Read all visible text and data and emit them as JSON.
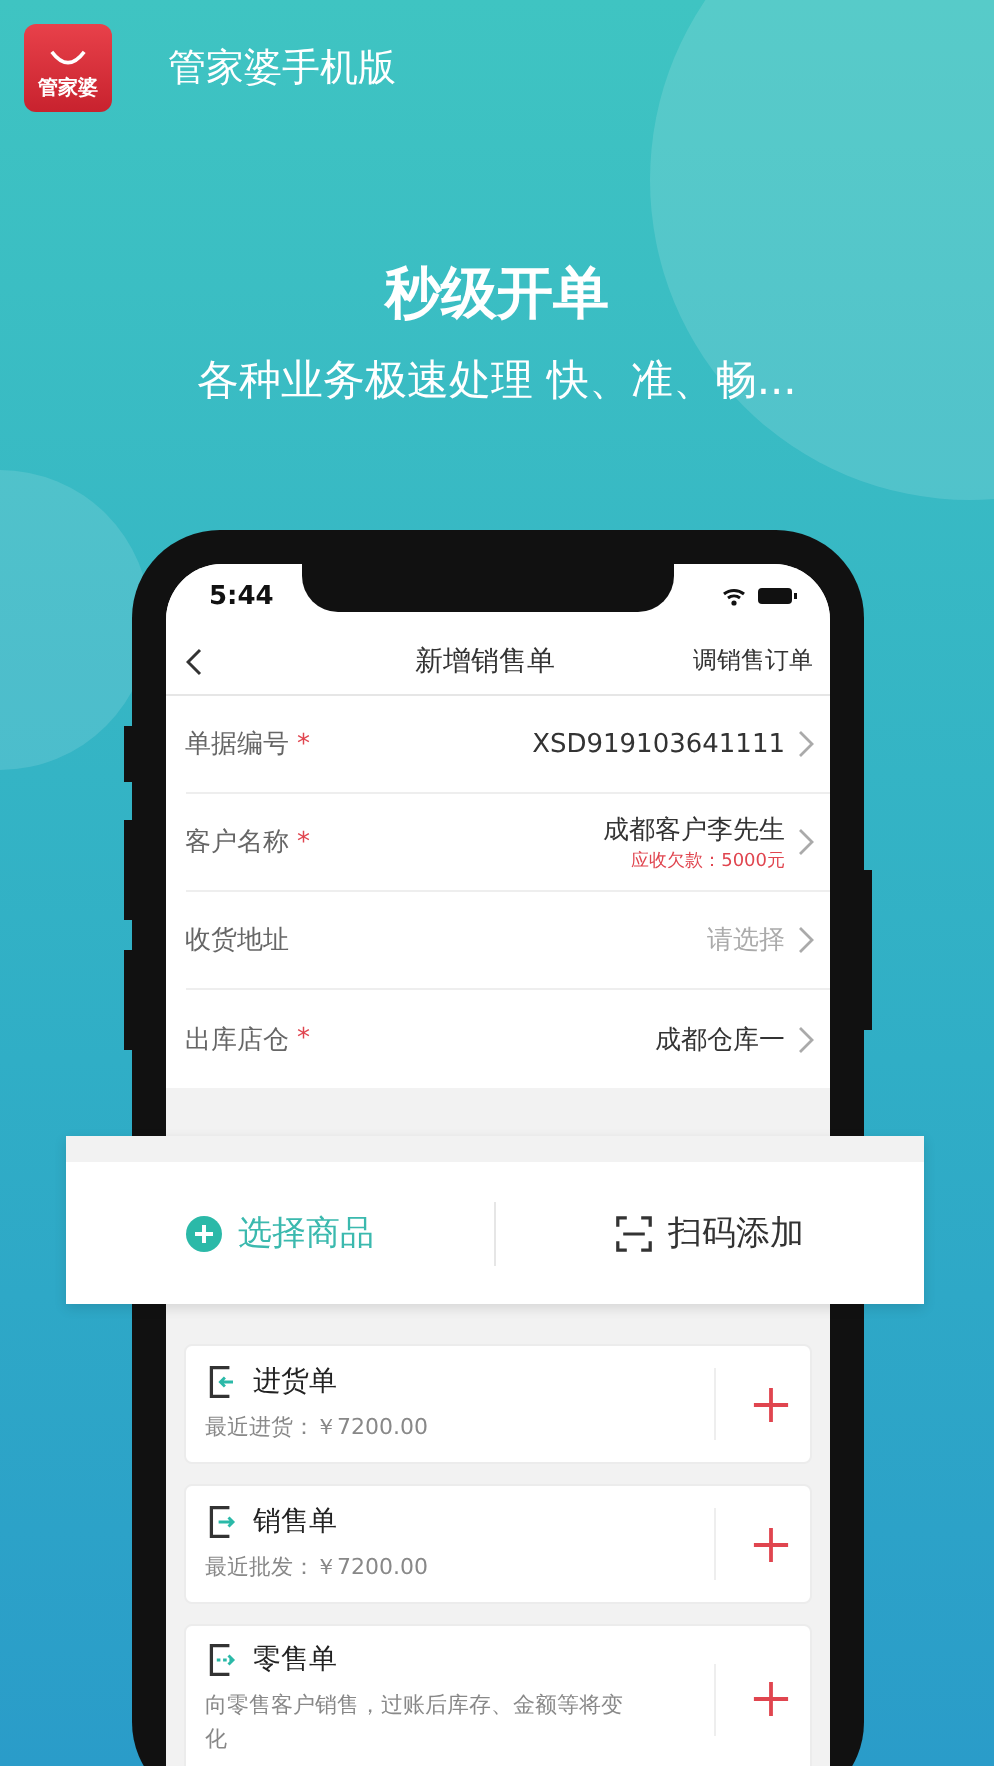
{
  "app": {
    "icon_label": "管家婆",
    "name": "管家婆手机版"
  },
  "headline": "秒级开单",
  "tagline": "各种业务极速处理 快、准、畅...",
  "phone": {
    "status_time": "5:44",
    "nav": {
      "title": "新增销售单",
      "action": "调销售订单"
    },
    "fields": [
      {
        "label": "单据编号",
        "required_mark": "*",
        "value": "XSD919103641111"
      },
      {
        "label": "客户名称",
        "required_mark": "*",
        "value": "成都客户李先生",
        "note": "应收欠款：5000元"
      },
      {
        "label": "收货地址",
        "placeholder": "请选择"
      },
      {
        "label": "出库店仓",
        "required_mark": "*",
        "value": "成都仓库一"
      }
    ],
    "actions": [
      {
        "kind": "add",
        "label": "选择商品"
      },
      {
        "kind": "scan",
        "label": "扫码添加"
      }
    ],
    "orders": [
      {
        "kind": "in",
        "title": "进货单",
        "detail": "最近进货：￥7200.00"
      },
      {
        "kind": "out",
        "title": "销售单",
        "detail": "最近批发：￥7200.00"
      },
      {
        "kind": "retail",
        "title": "零售单",
        "detail": "向零售客户销售，过账后库存、金额等将变化"
      }
    ]
  }
}
